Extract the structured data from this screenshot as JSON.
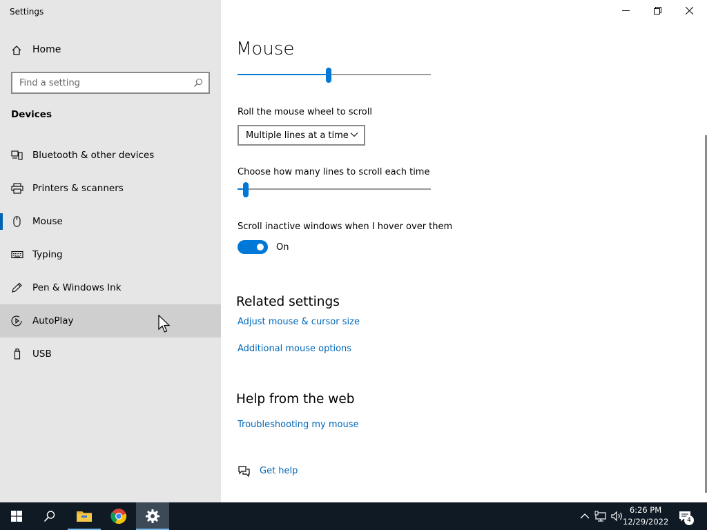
{
  "app": {
    "title": "Settings"
  },
  "sidebar": {
    "home_label": "Home",
    "search_placeholder": "Find a setting",
    "section_label": "Devices",
    "items": [
      {
        "label": "Bluetooth & other devices",
        "icon": "bluetooth-devices-icon"
      },
      {
        "label": "Printers & scanners",
        "icon": "printer-icon"
      },
      {
        "label": "Mouse",
        "icon": "mouse-icon",
        "selected": true
      },
      {
        "label": "Typing",
        "icon": "keyboard-icon"
      },
      {
        "label": "Pen & Windows Ink",
        "icon": "pen-icon"
      },
      {
        "label": "AutoPlay",
        "icon": "autoplay-icon",
        "hovered": true
      },
      {
        "label": "USB",
        "icon": "usb-icon"
      }
    ]
  },
  "main": {
    "title": "Mouse",
    "cursor_speed_fraction": 0.47,
    "wheel_label": "Roll the mouse wheel to scroll",
    "wheel_value": "Multiple lines at a time",
    "lines_label": "Choose how many lines to scroll each time",
    "lines_fraction": 0.03,
    "inactive_label": "Scroll inactive windows when I hover over them",
    "inactive_state": "On",
    "related_heading": "Related settings",
    "related_links": [
      "Adjust mouse & cursor size",
      "Additional mouse options"
    ],
    "help_heading": "Help from the web",
    "help_links": [
      "Troubleshooting my mouse"
    ],
    "get_help": "Get help"
  },
  "taskbar": {
    "time": "6:26 PM",
    "date": "12/29/2022",
    "notification_count": "4"
  },
  "colors": {
    "accent": "#0078d7",
    "link": "#0067b8",
    "sidebar_bg": "#e6e6e6",
    "taskbar_bg": "#101a24"
  }
}
